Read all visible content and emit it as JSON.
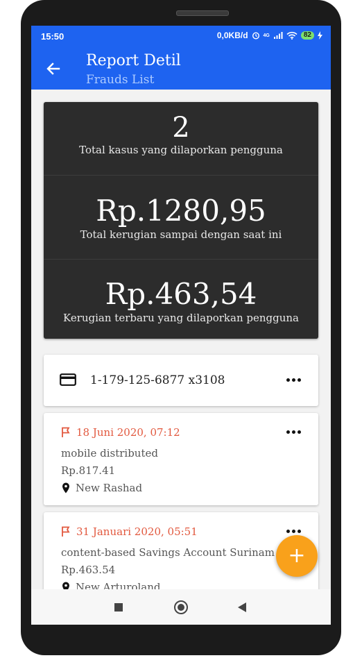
{
  "status": {
    "time": "15:50",
    "network": "0,0KB/d",
    "signal": "4G",
    "battery": "82"
  },
  "appbar": {
    "title": "Report Detil",
    "subtitle": "Frauds List"
  },
  "summary": [
    {
      "value": "2",
      "label": "Total kasus yang dilaporkan pengguna"
    },
    {
      "value": "Rp.1280,95",
      "label": "Total kerugian sampai dengan saat ini"
    },
    {
      "value": "Rp.463,54",
      "label": "Kerugian terbaru yang dilaporkan pengguna"
    }
  ],
  "account": {
    "number": "1-179-125-6877 x3108"
  },
  "reports": [
    {
      "date": "18 Juni 2020, 07:12",
      "description": "mobile distributed",
      "amount": "Rp.817.41",
      "location": "New Rashad"
    },
    {
      "date": "31 Januari 2020, 05:51",
      "description": "content-based Savings Account Surinam D",
      "amount": "Rp.463.54",
      "location": "New Arturoland"
    }
  ],
  "fab": {
    "label": "+"
  },
  "colors": {
    "primary": "#1e63f0",
    "accent": "#f9a11b",
    "date": "#e2583e",
    "summary_bg": "#2c2c2c"
  }
}
